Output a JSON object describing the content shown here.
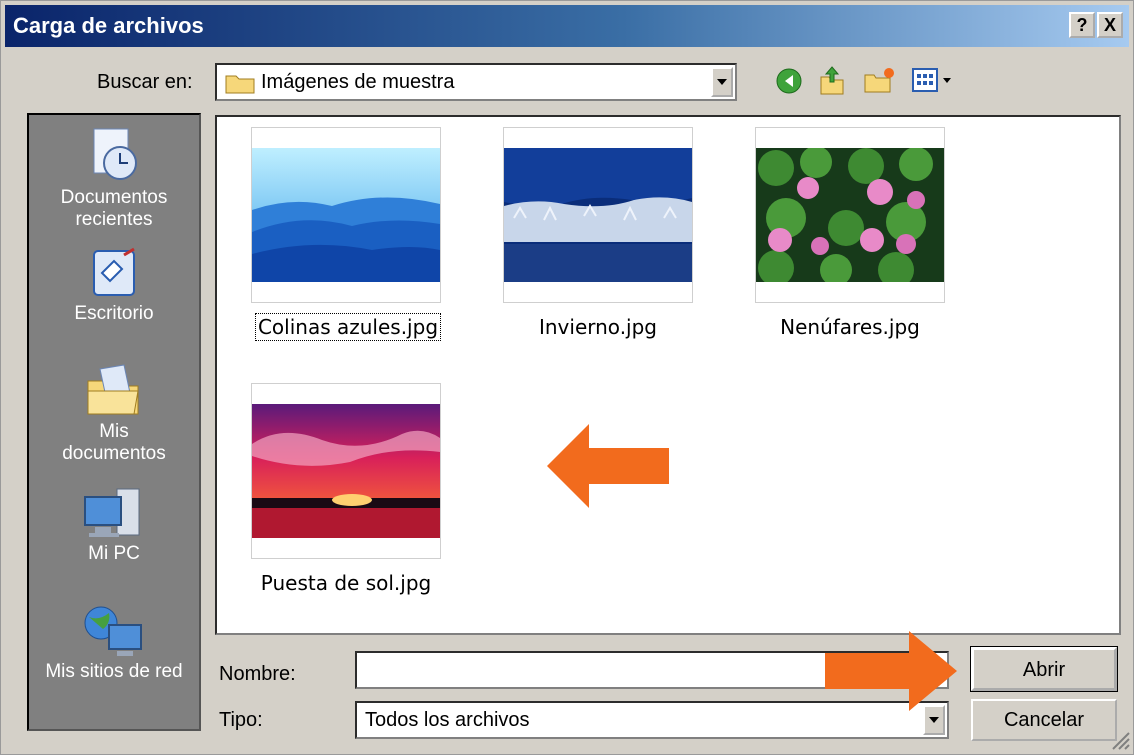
{
  "window": {
    "title": "Carga de archivos",
    "help_label": "?",
    "close_label": "X"
  },
  "toolbar": {
    "look_in_label": "Buscar en:",
    "look_in_value": "Imágenes de muestra"
  },
  "places": [
    {
      "label": "Documentos recientes",
      "icon": "recent-documents-icon"
    },
    {
      "label": "Escritorio",
      "icon": "desktop-icon"
    },
    {
      "label": "Mis documentos",
      "icon": "my-documents-icon"
    },
    {
      "label": "Mi PC",
      "icon": "my-computer-icon"
    },
    {
      "label": "Mis sitios de red",
      "icon": "network-places-icon"
    }
  ],
  "files": [
    {
      "name": "Colinas azules.jpg"
    },
    {
      "name": "Invierno.jpg"
    },
    {
      "name": "Nenúfares.jpg"
    },
    {
      "name": "Puesta de sol.jpg"
    }
  ],
  "form": {
    "name_label": "Nombre:",
    "name_value": "",
    "type_label": "Tipo:",
    "type_value": "Todos los archivos"
  },
  "buttons": {
    "open": "Abrir",
    "cancel": "Cancelar"
  },
  "colors": {
    "annotation_arrow": "#f26b1d",
    "titlebar": "#0a246a"
  }
}
